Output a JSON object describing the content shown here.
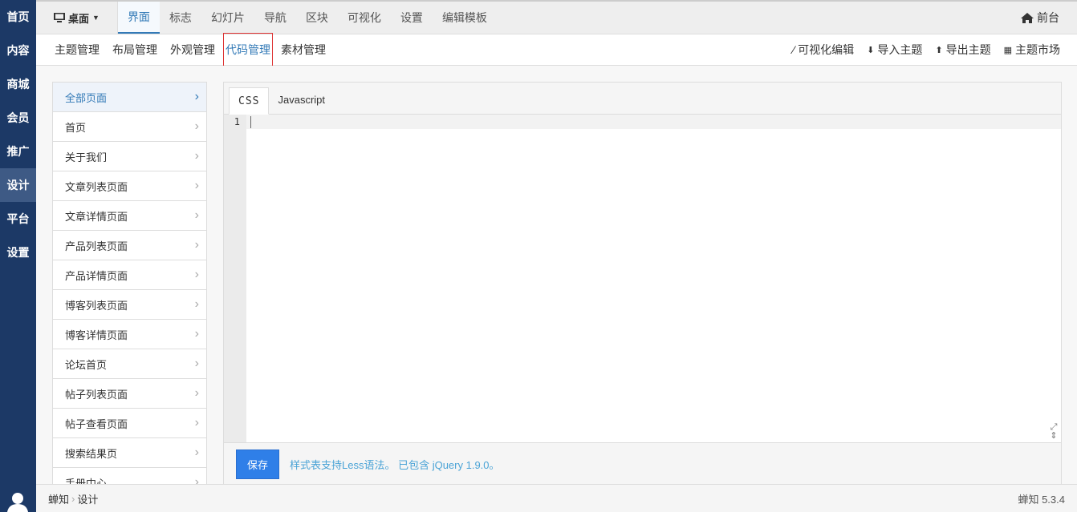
{
  "leftnav": [
    "首页",
    "内容",
    "商城",
    "会员",
    "推广",
    "设计",
    "平台",
    "设置"
  ],
  "topbar": {
    "device": "桌面",
    "tabs": [
      "界面",
      "标志",
      "幻灯片",
      "导航",
      "区块",
      "可视化",
      "设置",
      "编辑模板"
    ],
    "front": "前台"
  },
  "subbar": {
    "tabs": [
      "主题管理",
      "布局管理",
      "外观管理",
      "代码管理",
      "素材管理"
    ],
    "actions": [
      "可视化编辑",
      "导入主题",
      "导出主题",
      "主题市场"
    ]
  },
  "pages": [
    "全部页面",
    "首页",
    "关于我们",
    "文章列表页面",
    "文章详情页面",
    "产品列表页面",
    "产品详情页面",
    "博客列表页面",
    "博客详情页面",
    "论坛首页",
    "帖子列表页面",
    "帖子查看页面",
    "搜索结果页",
    "手册中心"
  ],
  "editor": {
    "tabs": [
      "CSS",
      "Javascript"
    ],
    "line": "1",
    "save": "保存",
    "hint": "样式表支持Less语法。 已包含 jQuery 1.9.0。"
  },
  "breadcrumb": [
    "蝉知",
    "设计"
  ],
  "version": "蝉知 5.3.4"
}
